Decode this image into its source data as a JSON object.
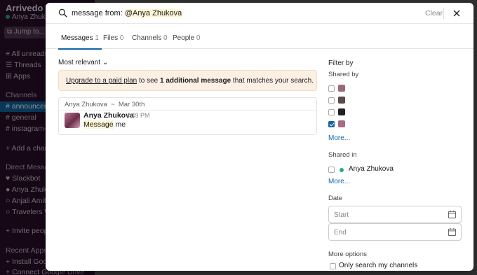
{
  "sidebar": {
    "workspace": "Arrivedo W",
    "user": "Anya Zhukov",
    "jump": "Jump to...",
    "nav": [
      "All unreads",
      "Threads",
      "Apps"
    ],
    "channels_header": "Channels",
    "channels": [
      "announcem",
      "general",
      "instagram-p"
    ],
    "add_channel": "Add a channe",
    "dm_header": "Direct Message",
    "dms": [
      "Slackbot",
      "Anya Zhuk",
      "Anjali Amit",
      "Travelers W"
    ],
    "invite": "Invite peop",
    "apps_header": "Recent Apps",
    "apps": [
      "Install Goog",
      "Connect Google Drive"
    ]
  },
  "search": {
    "query_prefix": "message from: ",
    "query_highlight": "@Anya Zhukova",
    "clear_label": "Clear"
  },
  "tabs": [
    {
      "label": "Messages",
      "count": "1"
    },
    {
      "label": "Files",
      "count": "0"
    },
    {
      "label": "Channels",
      "count": "0"
    },
    {
      "label": "People",
      "count": "0"
    }
  ],
  "sort": {
    "label": "Most relevant"
  },
  "upgrade": {
    "link": "Upgrade to a paid plan",
    "text1": " to see ",
    "bold": "1 additional message",
    "text2": " that matches your search."
  },
  "result": {
    "channel_meta": "Anya Zhukova",
    "separator": "~",
    "date": "Mar 30th",
    "author": "Anya Zhukova",
    "time": "4:49 PM",
    "text_highlight": "Message",
    "text_rest": " me"
  },
  "filter": {
    "title": "Filter by",
    "shared_by": "Shared by",
    "shared_by_checked": [
      false,
      false,
      false,
      true
    ],
    "more": "More...",
    "shared_in": "Shared in",
    "shared_in_item": "Anya Zhukova",
    "date": "Date",
    "start": "Start",
    "end": "End",
    "more_options": "More options",
    "only_my_channels": "Only search my channels"
  },
  "colors": {
    "accent": "#1264a3",
    "highlight": "#fef5d5",
    "upgrade_bg": "#fcf0e4",
    "online": "#2bac76"
  }
}
